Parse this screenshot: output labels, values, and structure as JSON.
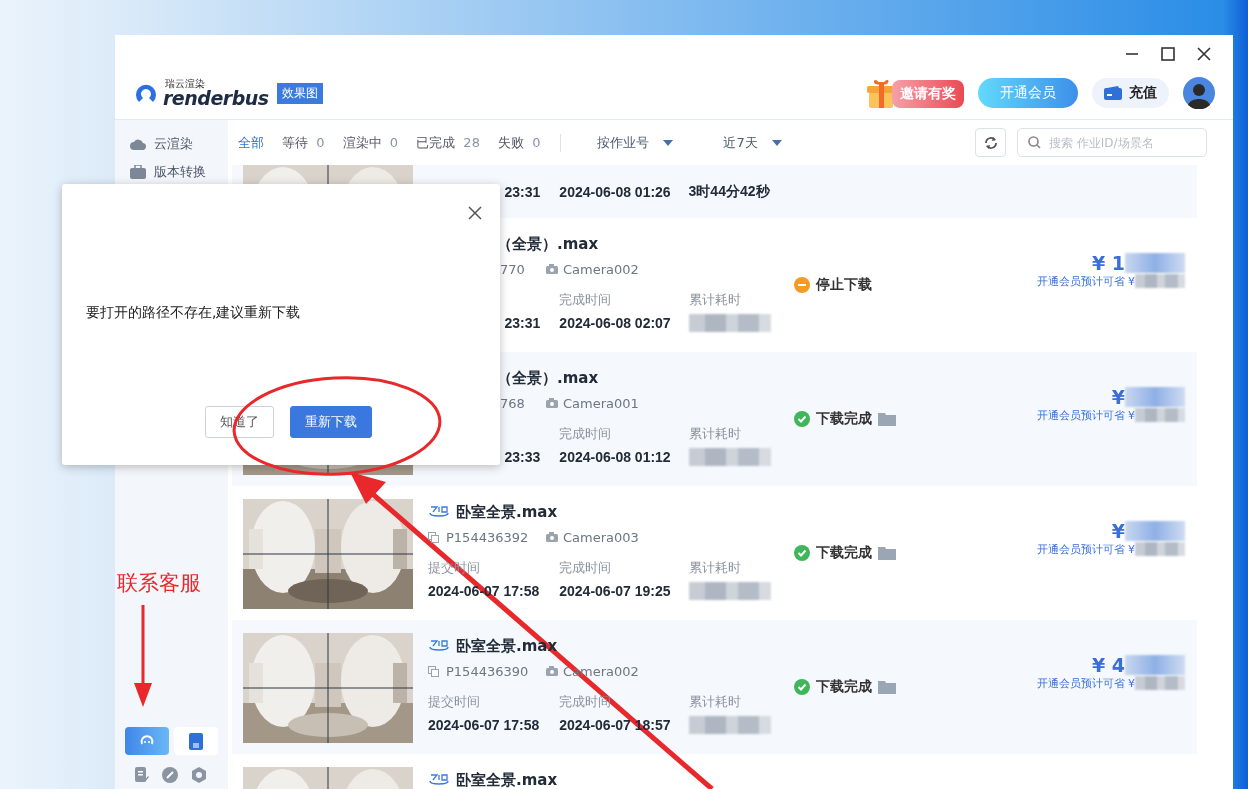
{
  "logo": {
    "subtitle": "瑞云渲染",
    "wordmark": "renderbus",
    "tag": "效果图"
  },
  "header_buttons": [
    {
      "kind": "invite",
      "label": "邀请有奖"
    },
    {
      "kind": "vip",
      "label": "开通会员"
    },
    {
      "kind": "recharge",
      "label": "充值"
    }
  ],
  "sidebar": {
    "items": [
      {
        "kind": "cloud",
        "label": "云渲染"
      },
      {
        "kind": "convert",
        "label": "版本转换"
      }
    ],
    "bottom_buttons": [
      {
        "kind": "support",
        "selected": true
      },
      {
        "kind": "document",
        "selected": false
      }
    ]
  },
  "filters": {
    "tabs": [
      {
        "label": "全部",
        "selected": true
      },
      {
        "label": "等待",
        "count": "0",
        "selected": false
      },
      {
        "label": "渲染中",
        "count": "0",
        "selected": false
      },
      {
        "label": "已完成",
        "count": "28",
        "selected": false
      },
      {
        "label": "失败",
        "count": "0",
        "selected": false
      }
    ],
    "sort": {
      "label": "按作业号"
    },
    "range": {
      "label": "近7天"
    },
    "search": {
      "placeholder": "搜索 作业ID/场景名"
    }
  },
  "rows": [
    {
      "kind": "top_cut",
      "submitted": "23:31",
      "finished": "2024-06-08 01:26",
      "duration": "3时44分42秒",
      "blurred": false
    },
    {
      "kind": "covered",
      "name": "（全景）.max",
      "job_id": "770",
      "camera": "Camera002",
      "finish_label": "完成时间",
      "duration_label": "累计耗时",
      "submitted": "23:31",
      "finished": "2024-06-08 02:07",
      "blurred": true,
      "status": {
        "kind": "stopped",
        "label": "停止下载"
      },
      "price": "¥ 1",
      "saving": "开通会员预计可省 ¥"
    },
    {
      "kind": "covered",
      "name": "（全景）.max",
      "job_id": "768",
      "camera": "Camera001",
      "finish_label": "完成时间",
      "duration_label": "累计耗时",
      "submitted": "23:33",
      "finished": "2024-06-08 01:12",
      "blurred": true,
      "status": {
        "kind": "done",
        "label": "下载完成"
      },
      "price": "¥",
      "saving": "开通会员预计可省 ¥"
    },
    {
      "kind": "full",
      "name": "卧室全景.max",
      "job_id": "P154436392",
      "camera": "Camera003",
      "submit_label": "提交时间",
      "finish_label": "完成时间",
      "duration_label": "累计耗时",
      "submitted": "2024-06-07 17:58",
      "finished": "2024-06-07 19:25",
      "blurred": true,
      "status": {
        "kind": "done",
        "label": "下载完成"
      },
      "price": "¥",
      "saving": "开通会员预计可省 ¥"
    },
    {
      "kind": "full",
      "name": "卧室全景.max",
      "job_id": "P154436390",
      "camera": "Camera002",
      "submit_label": "提交时间",
      "finish_label": "完成时间",
      "duration_label": "累计耗时",
      "submitted": "2024-06-07 17:58",
      "finished": "2024-06-07 18:57",
      "blurred": true,
      "status": {
        "kind": "done",
        "label": "下载完成"
      },
      "price": "¥ 4",
      "saving": "开通会员预计可省 ¥"
    },
    {
      "kind": "full",
      "name": "卧室全景.max",
      "blurred": false
    }
  ],
  "dialog": {
    "message": "要打开的路径不存在,建议重新下载",
    "buttons": [
      {
        "kind": "secondary",
        "label": "知道了"
      },
      {
        "kind": "primary",
        "label": "重新下载"
      }
    ]
  },
  "annotation": {
    "label": "联系客服"
  }
}
